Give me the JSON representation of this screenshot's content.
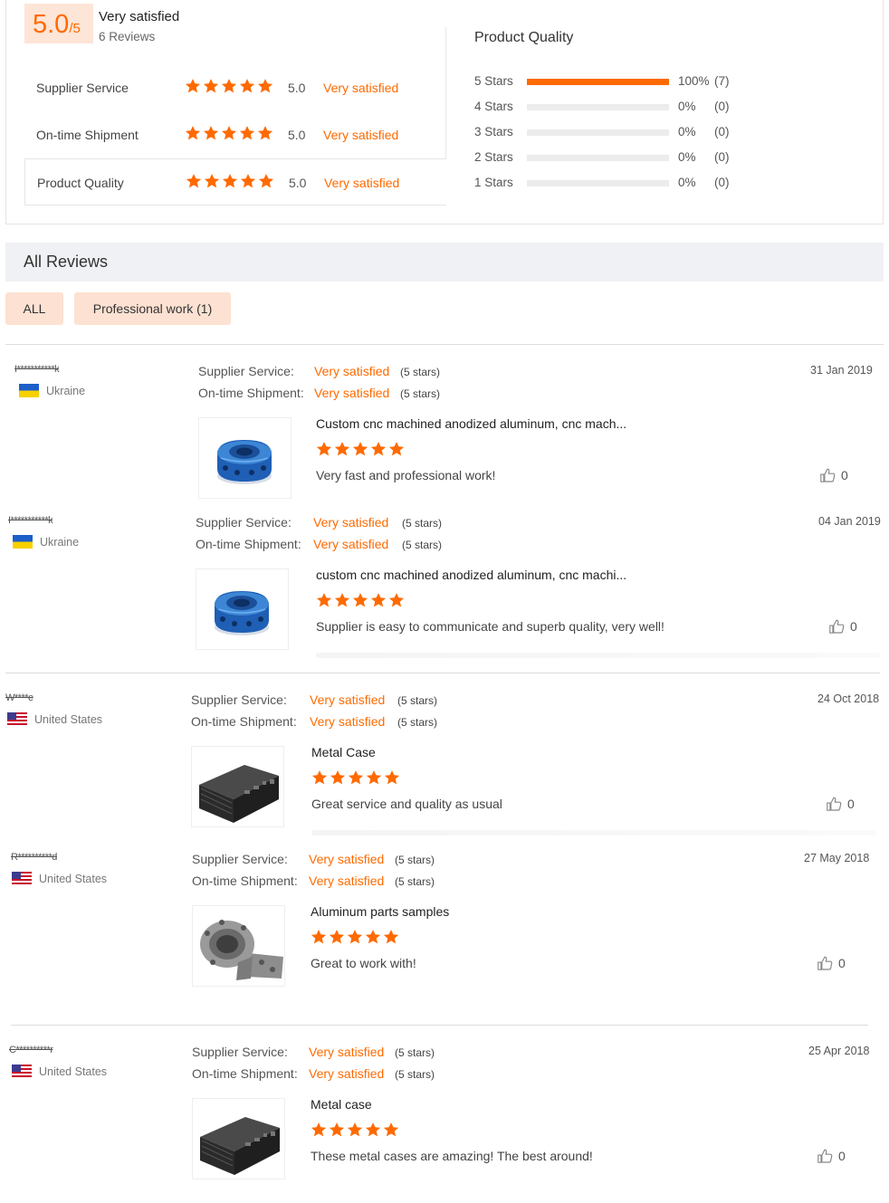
{
  "summary": {
    "score": "5.0",
    "score_suffix": "/5",
    "title": "Very satisfied",
    "reviews": "6 Reviews",
    "ratings": [
      {
        "label": "Supplier Service",
        "stars": 5,
        "value": "5.0",
        "desc": "Very satisfied"
      },
      {
        "label": "On-time Shipment",
        "stars": 5,
        "value": "5.0",
        "desc": "Very satisfied"
      },
      {
        "label": "Product Quality",
        "stars": 5,
        "value": "5.0",
        "desc": "Very satisfied"
      }
    ],
    "distribution": {
      "title": "Product Quality",
      "rows": [
        {
          "label": "5  Stars",
          "fraction": 1.0,
          "pct": "100%",
          "count": "(7)"
        },
        {
          "label": "4  Stars",
          "fraction": 0,
          "pct": "0%",
          "count": "(0)"
        },
        {
          "label": "3  Stars",
          "fraction": 0,
          "pct": "0%",
          "count": "(0)"
        },
        {
          "label": "2  Stars",
          "fraction": 0,
          "pct": "0%",
          "count": "(0)"
        },
        {
          "label": "1  Stars",
          "fraction": 0,
          "pct": "0%",
          "count": "(0)"
        }
      ]
    }
  },
  "all_reviews": {
    "heading": "All Reviews",
    "filters": [
      "ALL",
      "Professional work (1)"
    ]
  },
  "colors": {
    "accent": "#ff6a00",
    "light_accent": "#fde1d2"
  },
  "review_labels": {
    "supplier": "Supplier Service:",
    "shipment": "On-time Shipment:",
    "stars_note": "(5 stars)"
  },
  "reviews": [
    {
      "name": "I***********k",
      "country": "Ukraine",
      "flag": "ukraine-flag-icon",
      "supplier": "Very satisfied",
      "shipment": "Very satisfied",
      "date": "31 Jan 2019",
      "product": "Custom cnc machined anodized aluminum, cnc mach...",
      "image": "blue-anodized-part",
      "stars": 5,
      "text": "Very fast and professional work!",
      "likes": "0"
    },
    {
      "name": "I***********k",
      "country": "Ukraine",
      "flag": "ukraine-flag-icon",
      "supplier": "Very satisfied",
      "shipment": "Very satisfied",
      "date": "04 Jan 2019",
      "product": "custom cnc machined anodized aluminum, cnc machi...",
      "image": "blue-anodized-part",
      "stars": 5,
      "text": "Supplier is easy to communicate and superb quality, very well!",
      "likes": "0"
    },
    {
      "name": "W****e",
      "country": "United States",
      "flag": "us-flag-icon",
      "supplier": "Very satisfied",
      "shipment": "Very satisfied",
      "date": "24 Oct 2018",
      "product": "Metal Case",
      "image": "black-metal-case",
      "stars": 5,
      "text": "Great service and quality as usual",
      "likes": "0"
    },
    {
      "name": "R**********d",
      "country": "United States",
      "flag": "us-flag-icon",
      "supplier": "Very satisfied",
      "shipment": "Very satisfied",
      "date": "27 May 2018",
      "product": "Aluminum parts samples",
      "image": "aluminum-bracket-part",
      "stars": 5,
      "text": "Great to work with!",
      "likes": "0"
    },
    {
      "name": "C**********r",
      "country": "United States",
      "flag": "us-flag-icon",
      "supplier": "Very satisfied",
      "shipment": "Very satisfied",
      "date": "25 Apr 2018",
      "product": "Metal case",
      "image": "black-metal-case",
      "stars": 5,
      "text": "These metal cases are amazing! The best around!",
      "likes": "0"
    }
  ]
}
